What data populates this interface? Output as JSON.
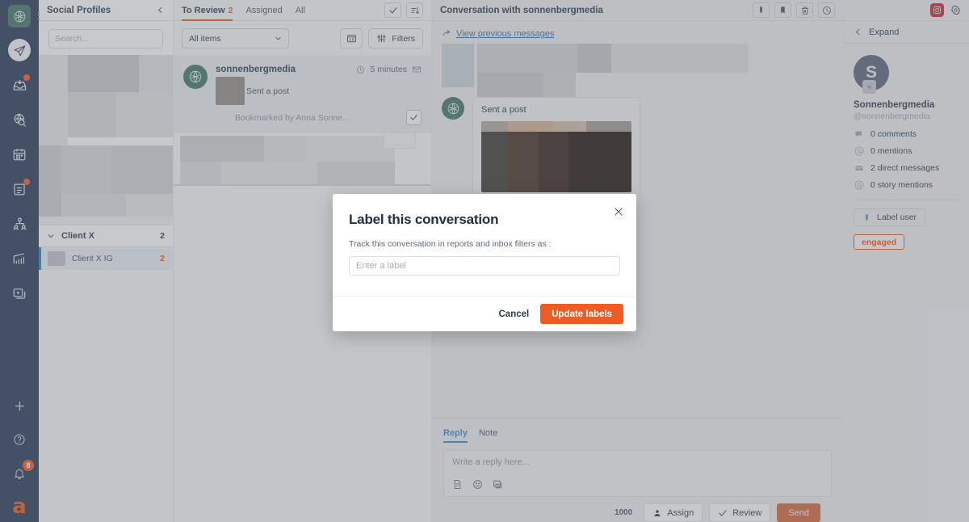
{
  "colors": {
    "rail_bg": "#283a56",
    "accent_orange": "#e2561f",
    "primary_orange": "#ef5b25",
    "link_blue": "#3a6ea5",
    "tab_blue": "#3a8bc9",
    "avatar_green": "#3f7368"
  },
  "rail": {
    "logo_icon": "knot-logo-icon",
    "menu_icon": "kebab-menu-icon",
    "items": [
      {
        "icon": "paper-plane-icon",
        "name": "publishing",
        "active": true,
        "badge": ""
      },
      {
        "icon": "inbox-tray-icon",
        "name": "inbox",
        "active": false,
        "badge": "dot"
      },
      {
        "icon": "globe-search-icon",
        "name": "listening",
        "active": false,
        "badge": ""
      },
      {
        "icon": "calendar-icon",
        "name": "calendar",
        "active": false,
        "badge": ""
      },
      {
        "icon": "tasks-clipboard-icon",
        "name": "tasks",
        "active": false,
        "badge": "dot"
      },
      {
        "icon": "people-group-icon",
        "name": "audience",
        "active": false,
        "badge": ""
      },
      {
        "icon": "bar-chart-icon",
        "name": "analytics",
        "active": false,
        "badge": ""
      },
      {
        "icon": "media-library-icon",
        "name": "media-library",
        "active": false,
        "badge": ""
      }
    ],
    "bottom": [
      {
        "icon": "plus-icon",
        "name": "create",
        "badge": ""
      },
      {
        "icon": "help-circle-icon",
        "name": "help",
        "badge": ""
      },
      {
        "icon": "bell-icon",
        "name": "notifications",
        "badge": "8"
      }
    ],
    "brand_glyph": "a"
  },
  "profiles": {
    "title": "Social Profiles",
    "collapse_icon": "chevron-left-icon",
    "search": {
      "placeholder": "Search...",
      "value": "",
      "icon": "search-icon"
    },
    "group": {
      "name": "Client X",
      "count": "2",
      "chevron": "chevron-down-icon"
    },
    "selected_profile": {
      "name": "Client X IG",
      "count": "2"
    }
  },
  "list": {
    "tabs": [
      {
        "label": "To Review",
        "count": "2",
        "active": true
      },
      {
        "label": "Assigned",
        "count": "",
        "active": false
      },
      {
        "label": "All",
        "count": "",
        "active": false
      }
    ],
    "header_actions": [
      {
        "icon": "check-mark-icon",
        "name": "mark-all-reviewed-button"
      },
      {
        "icon": "sort-descending-icon",
        "name": "sort-button"
      }
    ],
    "filter_select": {
      "value": "All items",
      "chevron": "chevron-down-icon"
    },
    "filter_actions": [
      {
        "icon": "date-range-icon",
        "name": "date-range-button",
        "label": ""
      },
      {
        "icon": "filters-icon",
        "name": "filters-button",
        "label": "Filters"
      }
    ],
    "conversation": {
      "user": "sonnenbergmedia",
      "preview_text": "Sent a post",
      "time": "5 minutes",
      "time_icon": "clock-icon",
      "type_icon": "envelope-icon",
      "bookmark_text": "Bookmarked by Anna Sonne...",
      "review_icon": "check-mark-icon"
    }
  },
  "conversation": {
    "title": "Conversation with sonnenbergmedia",
    "header_actions": [
      {
        "icon": "label-tag-icon",
        "name": "label-conversation-button"
      },
      {
        "icon": "bookmark-icon",
        "name": "bookmark-button"
      },
      {
        "icon": "trash-icon",
        "name": "delete-button"
      },
      {
        "icon": "clock-icon",
        "name": "snooze-button"
      }
    ],
    "view_previous": {
      "label": "View previous messages",
      "icon": "arrow-up-curve-icon"
    },
    "message": {
      "label": "Sent a post"
    },
    "composer": {
      "tabs": [
        {
          "label": "Reply",
          "active": true
        },
        {
          "label": "Note",
          "active": false
        }
      ],
      "placeholder": "Write a reply here...",
      "value": "",
      "tools": [
        {
          "icon": "saved-replies-icon",
          "name": "saved-replies-button"
        },
        {
          "icon": "emoji-icon",
          "name": "emoji-button"
        },
        {
          "icon": "image-icon",
          "name": "attach-image-button"
        }
      ],
      "char_count": "1000",
      "assign_label": "Assign",
      "assign_icon": "person-icon",
      "review_label": "Review",
      "review_icon": "check-mark-icon",
      "send_label": "Send"
    }
  },
  "right_panel": {
    "instagram_icon": "instagram-icon",
    "settings_icon": "gear-icon",
    "expand": {
      "label": "Expand",
      "icon": "chevron-left-icon"
    },
    "avatar_initial": "S",
    "avatar_badge_icon": "star-icon",
    "name": "Sonnenbergmedia",
    "handle": "@sonnenbergmedia",
    "stats": [
      {
        "icon": "comment-icon",
        "label": "0 comments"
      },
      {
        "icon": "at-sign-icon",
        "label": "0 mentions"
      },
      {
        "icon": "envelope-icon",
        "label": "2 direct messages"
      },
      {
        "icon": "at-sign-icon",
        "label": "0 story mentions"
      }
    ],
    "label_user": {
      "label": "Label user",
      "icon": "label-tag-icon"
    },
    "tags": [
      "engaged"
    ]
  },
  "modal": {
    "title": "Label this conversation",
    "subtitle": "Track this conversation in reports and inbox filters as :",
    "input": {
      "placeholder": "Enter a label",
      "value": ""
    },
    "cancel_label": "Cancel",
    "submit_label": "Update labels",
    "close_icon": "close-icon"
  }
}
